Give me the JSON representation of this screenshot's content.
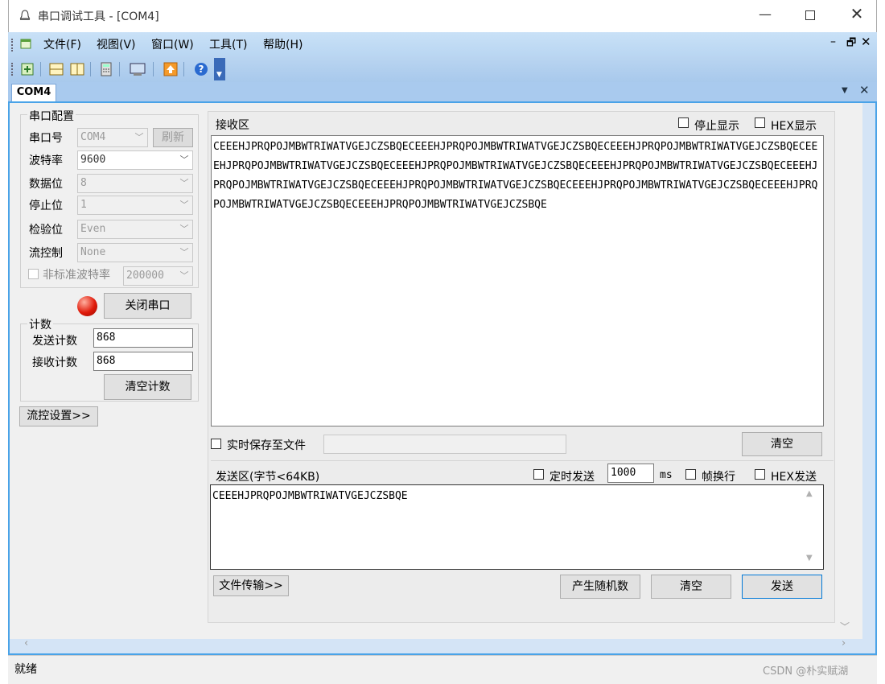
{
  "window": {
    "title": "串口调试工具 - [COM4]"
  },
  "menu": [
    "文件(F)",
    "视图(V)",
    "窗口(W)",
    "工具(T)",
    "帮助(H)"
  ],
  "tab": {
    "label": "COM4"
  },
  "serial_config": {
    "title": "串口配置",
    "port_label": "串口号",
    "port_value": "COM4",
    "refresh_label": "刷新",
    "baud_label": "波特率",
    "baud_value": "9600",
    "databits_label": "数据位",
    "databits_value": "8",
    "stopbits_label": "停止位",
    "stopbits_value": "1",
    "parity_label": "检验位",
    "parity_value": "Even",
    "flow_label": "流控制",
    "flow_value": "None",
    "nonstd_label": "非标准波特率",
    "nonstd_value": "200000",
    "close_port_label": "关闭串口"
  },
  "counter": {
    "title": "计数",
    "send_label": "发送计数",
    "send_value": "868",
    "recv_label": "接收计数",
    "recv_value": "868",
    "clear_label": "清空计数"
  },
  "flow_settings_label": "流控设置>>",
  "receive": {
    "title": "接收区",
    "stop_display_label": "停止显示",
    "hex_display_label": "HEX显示",
    "content": "CEEEHJPRQPOJMBWTRIWATVGEJCZSBQECEEEHJPRQPOJMBWTRIWATVGEJCZSBQECEEEHJPRQPOJMBWTRIWATVGEJCZSBQECEEEHJPRQPOJMBWTRIWATVGEJCZSBQECEEEHJPRQPOJMBWTRIWATVGEJCZSBQECEEEHJPRQPOJMBWTRIWATVGEJCZSBQECEEEHJPRQPOJMBWTRIWATVGEJCZSBQECEEEHJPRQPOJMBWTRIWATVGEJCZSBQECEEEHJPRQPOJMBWTRIWATVGEJCZSBQECEEEHJPRQPOJMBWTRIWATVGEJCZSBQECEEEHJPRQPOJMBWTRIWATVGEJCZSBQE",
    "save_file_label": "实时保存至文件",
    "clear_label": "清空"
  },
  "send": {
    "title": "发送区(字节<64KB)",
    "timed_label": "定时发送",
    "interval_value": "1000",
    "interval_unit": "ms",
    "frame_newline_label": "帧换行",
    "hex_send_label": "HEX发送",
    "content": "CEEEHJPRQPOJMBWTRIWATVGEJCZSBQE",
    "file_transfer_label": "文件传输>>",
    "random_label": "产生随机数",
    "clear_label": "清空",
    "send_label": "发送"
  },
  "status": {
    "text": "就绪"
  },
  "watermark": "CSDN @朴实赋湖"
}
